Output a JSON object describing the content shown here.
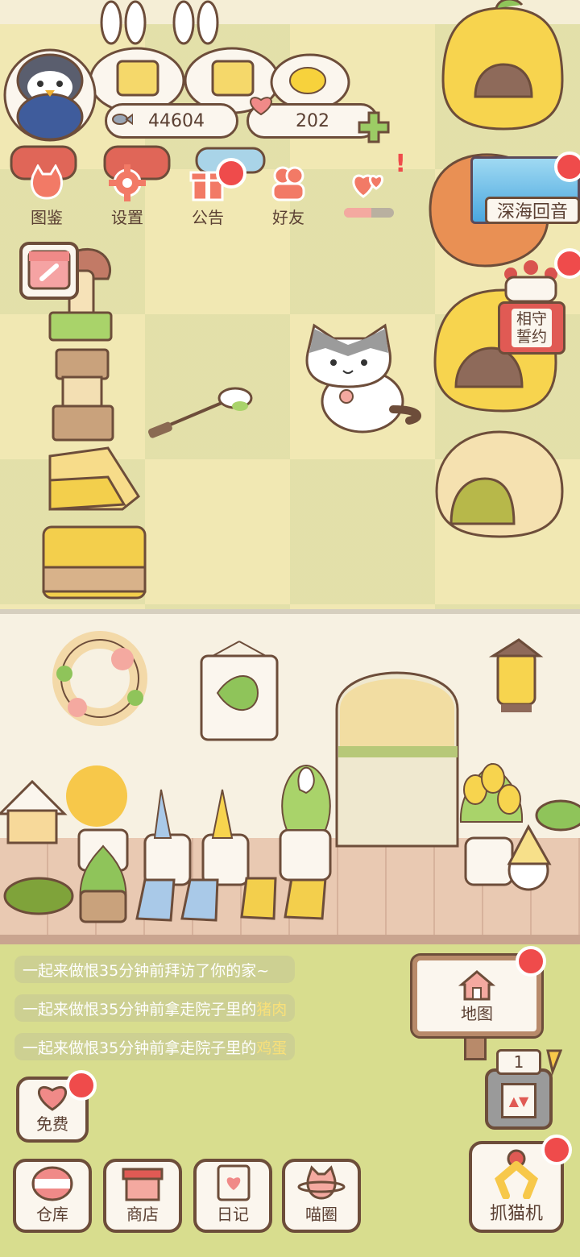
{
  "resources": {
    "fish_count": "44604",
    "heart_count": "202"
  },
  "menu": [
    {
      "label": "图鉴",
      "icon": "cat-head-icon"
    },
    {
      "label": "设置",
      "icon": "gear-icon"
    },
    {
      "label": "公告",
      "icon": "gift-icon"
    },
    {
      "label": "好友",
      "icon": "friends-icon"
    },
    {
      "label": "",
      "icon": "hearts-icon"
    }
  ],
  "events": {
    "deep_sea_label": "深海回音",
    "pledge_label_line1": "相守",
    "pledge_label_line2": "誓约"
  },
  "activity_log": [
    {
      "name": "一起来做恨",
      "text": "35分钟前拜访了你的家~",
      "item": ""
    },
    {
      "name": "一起来做恨",
      "text": "35分钟前拿走院子里的",
      "item": "猪肉"
    },
    {
      "name": "一起来做恨",
      "text": "35分钟前拿走院子里的",
      "item": "鸡蛋"
    }
  ],
  "map_sign": {
    "label": "地图"
  },
  "claw_counter": "1",
  "bottom_bar": {
    "free": "免费",
    "warehouse": "仓库",
    "shop": "商店",
    "diary": "日记",
    "circle": "喵圈",
    "claw_machine": "抓猫机"
  },
  "colors": {
    "outline": "#6d4d3a",
    "badge_red": "#ef4b4b",
    "text_brown": "#5b4033"
  }
}
